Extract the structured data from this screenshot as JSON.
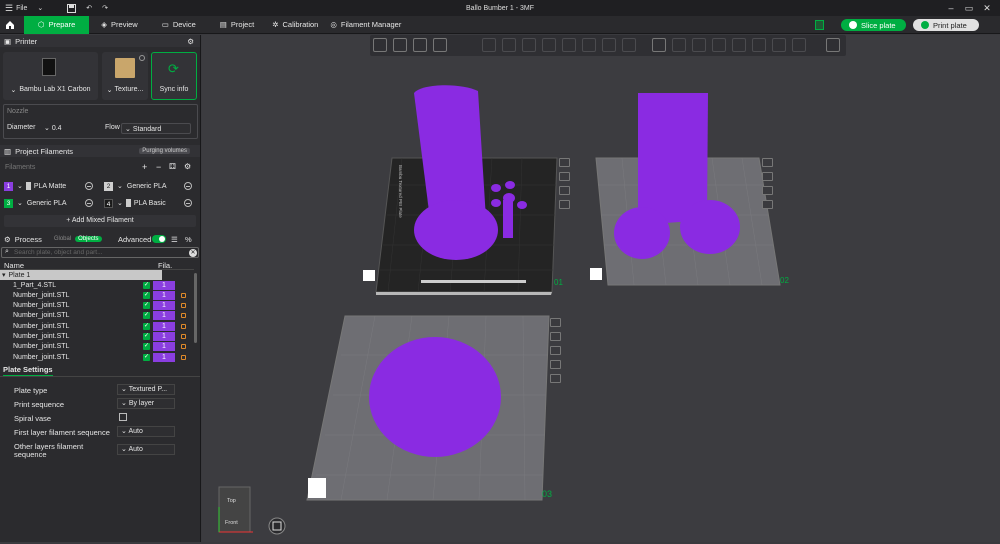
{
  "window": {
    "title": "Ballo Bumber 1 - 3MF",
    "file_menu": "File"
  },
  "nav": {
    "prepare": "Prepare",
    "preview": "Preview",
    "device": "Device",
    "project": "Project",
    "calibration": "Calibration",
    "filament_manager": "Filament Manager",
    "slice": "Slice plate",
    "print": "Print plate"
  },
  "printer": {
    "header": "Printer",
    "name": "Bambu Lab X1 Carbon",
    "plate": "Texture...",
    "sync": "Sync info",
    "nozzle_label": "Nozzle",
    "diameter_label": "Diameter",
    "diameter": "0.4",
    "flow_label": "Flow",
    "flow": "Standard"
  },
  "filaments": {
    "header": "Project Filaments",
    "purge": "Purging volumes",
    "label": "Filaments",
    "items": [
      {
        "num": "1",
        "name": "PLA Matte",
        "color": "#8a3ee0"
      },
      {
        "num": "2",
        "name": "Generic PLA",
        "color": "#cfcfcf"
      },
      {
        "num": "3",
        "name": "Generic PLA",
        "color": "#00ae42"
      },
      {
        "num": "4",
        "name": "PLA Basic",
        "color": "#1a1a1a"
      }
    ],
    "add_mixed": "+ Add Mixed Filament"
  },
  "process": {
    "header": "Process",
    "global": "Global",
    "objects": "Objects",
    "advanced": "Advanced",
    "search_placeholder": "Search plate, object and part...",
    "col_name": "Name",
    "col_fila": "Fila.",
    "plate": "Plate 1",
    "objects_list": [
      "1_Part_4.STL",
      "Number_joint.STL",
      "Number_joint.STL",
      "Number_joint.STL",
      "Number_joint.STL",
      "Number_joint.STL",
      "Number_joint.STL",
      "Number_joint.STL"
    ],
    "fila_value": "1"
  },
  "plate_settings": {
    "header": "Plate Settings",
    "rows": [
      {
        "label": "Plate type",
        "value": "Textured P..."
      },
      {
        "label": "Print sequence",
        "value": "By layer"
      },
      {
        "label": "Spiral vase",
        "value": ""
      },
      {
        "label": "First layer filament sequence",
        "value": "Auto"
      },
      {
        "label": "Other layers filament",
        "label2": "sequence",
        "value": "Auto"
      }
    ]
  },
  "viewport": {
    "plate_labels": [
      "01",
      "02",
      "03"
    ],
    "plate_vertical_text": "Bambu Textured PEI Plate",
    "view_cube": {
      "top": "Top",
      "front": "Front"
    },
    "model_color": "#8a2be2"
  }
}
